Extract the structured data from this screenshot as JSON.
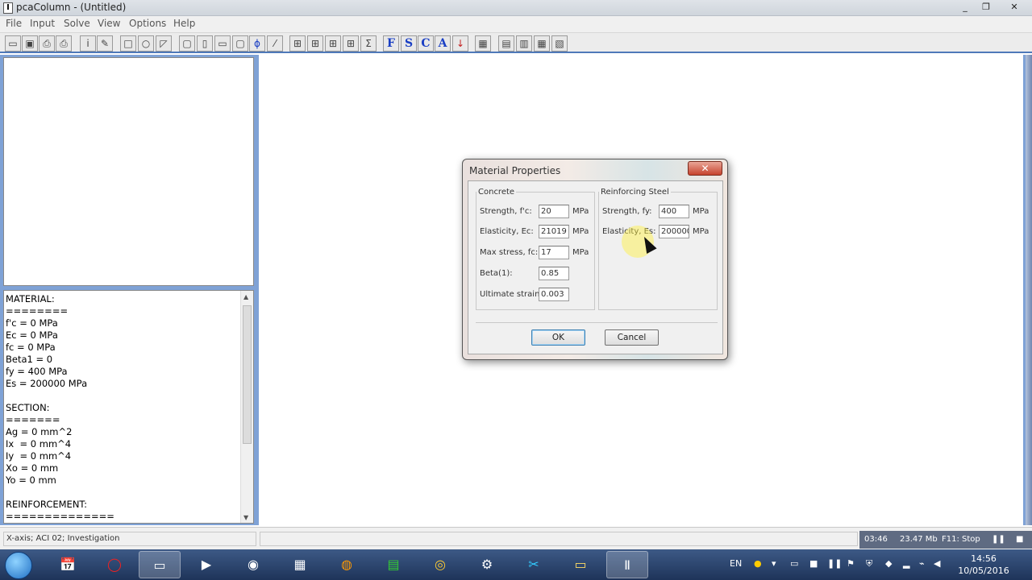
{
  "window": {
    "title": "pcaColumn - (Untitled)",
    "controls": [
      "_",
      "❐",
      "✕"
    ]
  },
  "menubar": [
    "File",
    "Input",
    "Solve",
    "View",
    "Options",
    "Help"
  ],
  "toolbar": {
    "section_letters": [
      "F",
      "S",
      "C",
      "A"
    ]
  },
  "report": {
    "text": "MATERIAL:\n========\nf'c = 0 MPa\nEc = 0 MPa\nfc = 0 MPa\nBeta1 = 0\nfy = 400 MPa\nEs = 200000 MPa\n\nSECTION:\n=======\nAg = 0 mm^2\nIx  = 0 mm^4\nIy  = 0 mm^4\nXo = 0 mm\nYo = 0 mm\n\nREINFORCEMENT:\n=============="
  },
  "statusbar": {
    "left": "X-axis; ACI 02; Investigation",
    "time": "03:46",
    "memory": "23.47 Mb",
    "f11": "F11: Stop"
  },
  "taskbar": {
    "lang": "EN",
    "clock_time": "14:56",
    "clock_date": "10/05/2016"
  },
  "dialog": {
    "title": "Material Properties",
    "close": "✕",
    "concrete": {
      "legend": "Concrete",
      "strength_label": "Strength, f'c:",
      "strength_value": "20",
      "elasticity_label": "Elasticity, Ec:",
      "elasticity_value": "21019",
      "maxstress_label": "Max stress, fc:",
      "maxstress_value": "17",
      "beta_label": "Beta(1):",
      "beta_value": "0.85",
      "ultimate_label": "Ultimate strain:",
      "ultimate_value": "0.003",
      "unit": "MPa"
    },
    "steel": {
      "legend": "Reinforcing Steel",
      "strength_label": "Strength, fy:",
      "strength_value": "400",
      "elasticity_label": "Elasticity, Es:",
      "elasticity_value": "200000",
      "unit": "MPa"
    },
    "ok_label": "OK",
    "cancel_label": "Cancel"
  }
}
